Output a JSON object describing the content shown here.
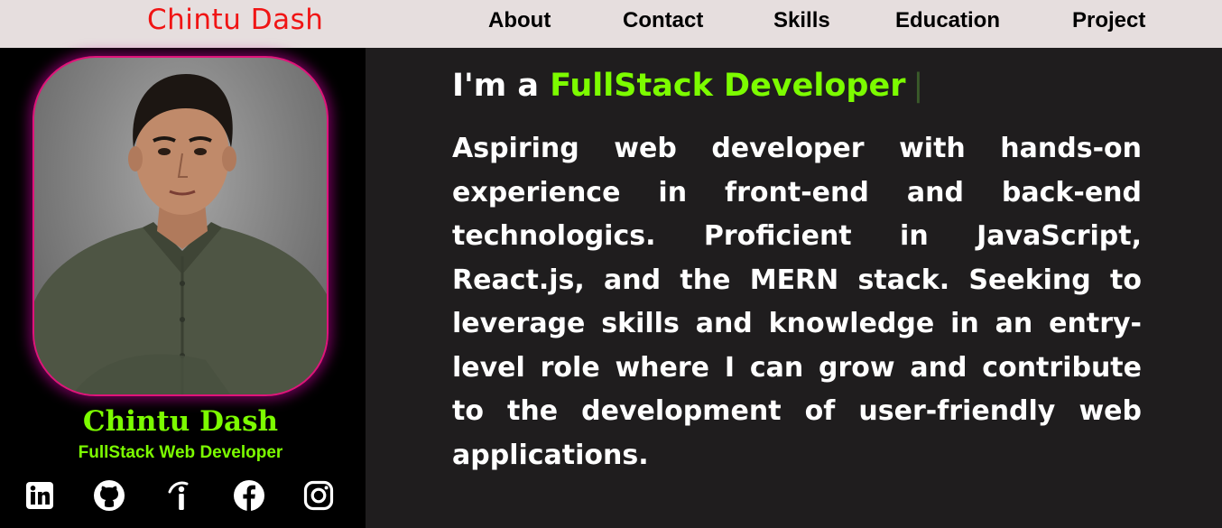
{
  "nav": {
    "brand": "Chintu Dash",
    "links": [
      "About",
      "Contact",
      "Skills",
      "Education",
      "Project"
    ]
  },
  "sidebar": {
    "name": "Chintu Dash",
    "role": "FullStack Web Developer",
    "socials": [
      "linkedin-icon",
      "github-icon",
      "info-icon",
      "facebook-icon",
      "instagram-icon"
    ]
  },
  "main": {
    "headline_prefix": "I'm a ",
    "headline_highlight": "FullStack Developer",
    "headline_caret": "|",
    "about": "Aspiring web developer with hands-on experience in front-end and back-end technologics. Proficient in JavaScript, React.js, and the MERN stack. Seeking to leverage skills and knowledge in an entry-level role where I can grow and contribute to the development of user-friendly web applications."
  },
  "colors": {
    "accent_green": "#7cfc00",
    "brand_red": "#f01414",
    "nav_bg": "#e6dede",
    "main_bg": "#1f1d1e",
    "frame_glow": "#e0147a"
  }
}
